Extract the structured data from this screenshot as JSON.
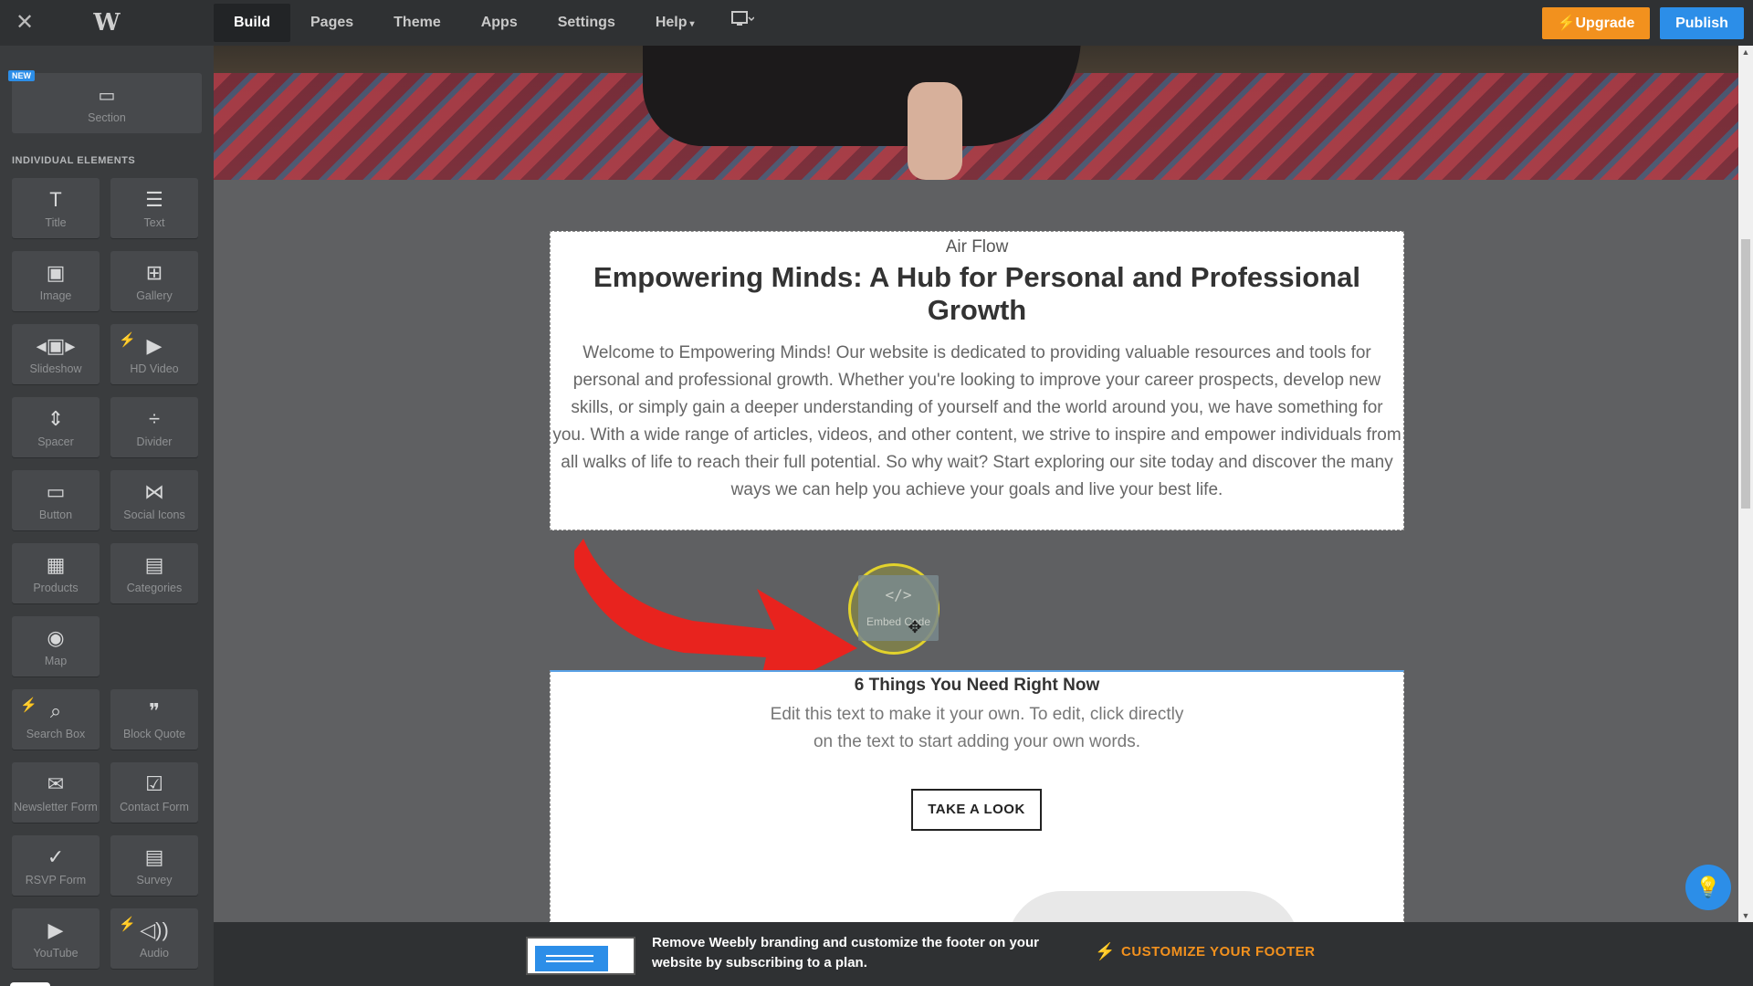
{
  "topbar": {
    "nav": [
      "Build",
      "Pages",
      "Theme",
      "Apps",
      "Settings",
      "Help"
    ],
    "active_tab": "Build",
    "help_caret": "▾",
    "upgrade_label": "Upgrade",
    "publish_label": "Publish"
  },
  "sidebar": {
    "new_badge": "NEW",
    "section_label": "Section",
    "heading": "INDIVIDUAL ELEMENTS",
    "elements": [
      {
        "label": "Title",
        "icon": "T"
      },
      {
        "label": "Text",
        "icon": "☰"
      },
      {
        "label": "Image",
        "icon": "▣"
      },
      {
        "label": "Gallery",
        "icon": "⊞"
      },
      {
        "label": "Slideshow",
        "icon": "◂▣▸"
      },
      {
        "label": "HD Video",
        "icon": "▶",
        "premium": true
      },
      {
        "label": "Spacer",
        "icon": "⇕"
      },
      {
        "label": "Divider",
        "icon": "÷"
      },
      {
        "label": "Button",
        "icon": "▭"
      },
      {
        "label": "Social Icons",
        "icon": "⋈"
      },
      {
        "label": "Products",
        "icon": "▦"
      },
      {
        "label": "Categories",
        "icon": "▤"
      },
      {
        "label": "Map",
        "icon": "◉"
      },
      {
        "label": "Search Box",
        "icon": "⌕",
        "premium": true
      },
      {
        "label": "Block Quote",
        "icon": "❞"
      },
      {
        "label": "Newsletter Form",
        "icon": "✉"
      },
      {
        "label": "Contact Form",
        "icon": "☑"
      },
      {
        "label": "RSVP Form",
        "icon": "✓"
      },
      {
        "label": "Survey",
        "icon": "▤"
      },
      {
        "label": "YouTube",
        "icon": "▶"
      },
      {
        "label": "Audio",
        "icon": "◁))",
        "premium": true
      }
    ]
  },
  "canvas": {
    "block1": {
      "subtitle": "Air Flow",
      "title": "Empowering Minds: A Hub for Personal and Professional Growth",
      "body": "Welcome to Empowering Minds! Our website is dedicated to providing valuable resources and tools for personal and professional growth. Whether you're looking to improve your career prospects, develop new skills, or simply gain a deeper understanding of yourself and the world around you, we have something for you. With a wide range of articles, videos, and other content, we strive to inspire and empower individuals from all walks of life to reach their full potential. So why wait? Start exploring our site today and discover the many ways we can help you achieve your goals and live your best life."
    },
    "drag_item": {
      "label": "Embed Code",
      "icon": "</>"
    },
    "block2": {
      "title": "6 Things You Need Right Now",
      "body_line1": "Edit this text to make it your own. To edit, click directly",
      "body_line2": "on the text to start adding your own words.",
      "button_label": "TAKE A LOOK"
    }
  },
  "footer": {
    "message": "Remove Weebly branding and customize the footer on your website by subscribing to a plan.",
    "cta": "CUSTOMIZE YOUR FOOTER"
  },
  "colors": {
    "accent_orange": "#f2911e",
    "accent_blue": "#2c8ee8",
    "arrow_red": "#e8231e"
  }
}
